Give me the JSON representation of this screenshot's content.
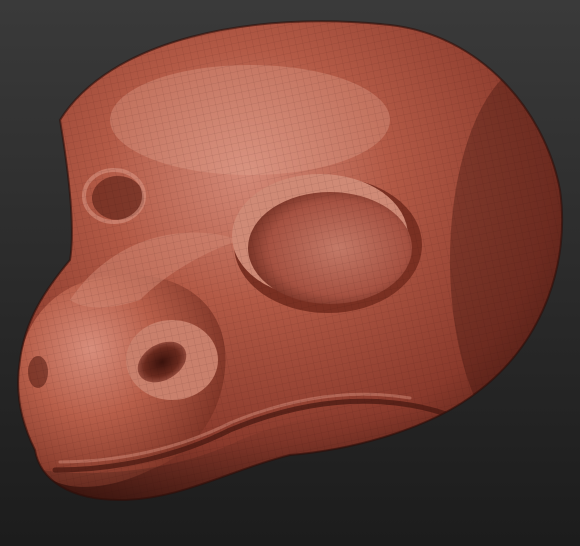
{
  "scene": {
    "subject": "head-sculpt",
    "colors": {
      "background_top": "#3a3a3a",
      "background_bottom": "#1c1c1c",
      "clay_light": "#d48a78",
      "clay_mid": "#a8503e",
      "clay_dark": "#5e2218",
      "clay_shadow": "#3a120c"
    }
  }
}
